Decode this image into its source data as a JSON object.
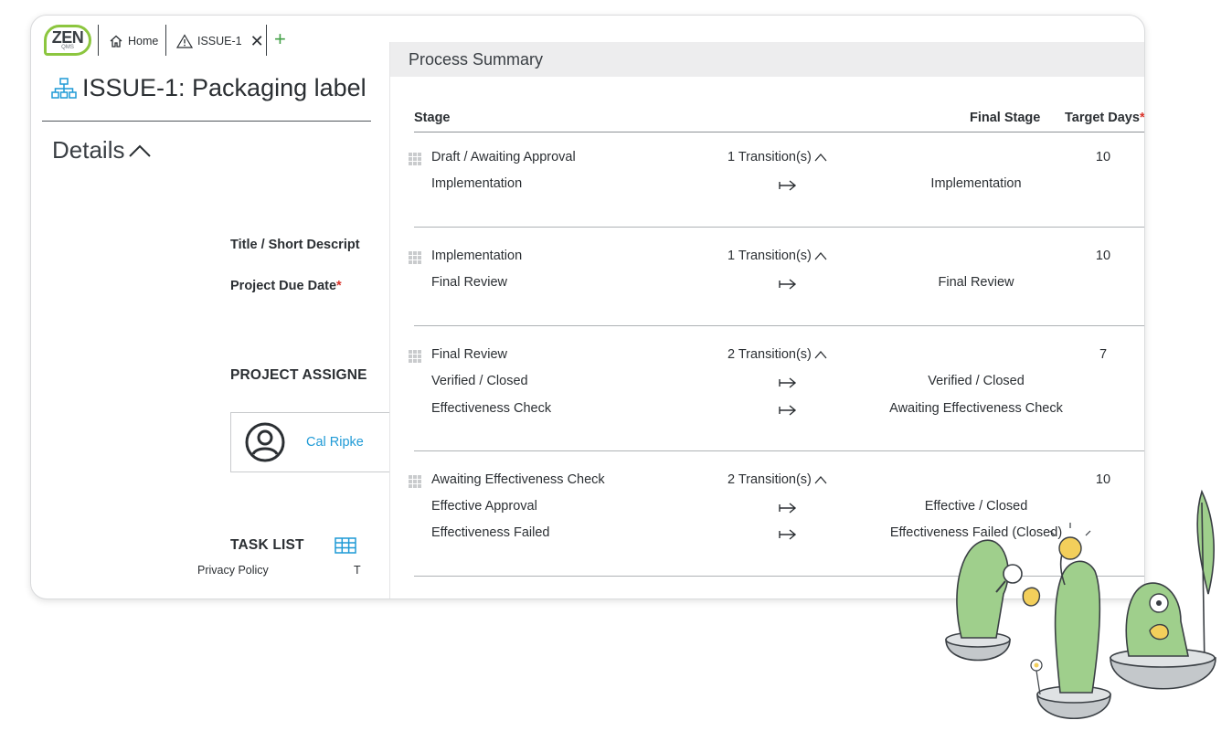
{
  "app": {
    "logo_text": "ZEN",
    "logo_sub": "QMS"
  },
  "tabs": [
    {
      "label": "Home",
      "icon": "home-icon"
    },
    {
      "label": "ISSUE-1",
      "icon": "warning-icon"
    }
  ],
  "page": {
    "title": "ISSUE-1: Packaging label",
    "title_icon": "org-chart-icon"
  },
  "details": {
    "heading": "Details",
    "fields": {
      "title_label": "Title / Short Descript",
      "due_date_label": "Project Due Date",
      "required_mark": "*"
    },
    "assignees_label": "PROJECT ASSIGNE",
    "assignee_name": "Cal Ripke",
    "task_list_label": "TASK LIST"
  },
  "footer": {
    "privacy": "Privacy Policy",
    "terms": "T"
  },
  "summary": {
    "title": "Process Summary",
    "columns": {
      "stage": "Stage",
      "final_stage": "Final Stage",
      "target_days": "Target Days",
      "required_mark": "*"
    },
    "stages": [
      {
        "name": "Draft / Awaiting Approval",
        "transitions_label": "1 Transition(s)",
        "target_days": "10",
        "transitions": [
          {
            "name": "Implementation",
            "final_stage": "Implementation"
          }
        ]
      },
      {
        "name": "Implementation",
        "transitions_label": "1 Transition(s)",
        "target_days": "10",
        "transitions": [
          {
            "name": "Final Review",
            "final_stage": "Final Review"
          }
        ]
      },
      {
        "name": "Final Review",
        "transitions_label": "2 Transition(s)",
        "target_days": "7",
        "transitions": [
          {
            "name": "Verified / Closed",
            "final_stage": "Verified / Closed"
          },
          {
            "name": "Effectiveness Check",
            "final_stage": "Awaiting Effectiveness Check"
          }
        ]
      },
      {
        "name": "Awaiting Effectiveness Check",
        "transitions_label": "2 Transition(s)",
        "target_days": "10",
        "transitions": [
          {
            "name": "Effective Approval",
            "final_stage": "Effective / Closed"
          },
          {
            "name": "Effectiveness Failed",
            "final_stage": "Effectiveness Failed (Closed)"
          }
        ]
      }
    ]
  },
  "colors": {
    "accent_green": "#8cc63f",
    "link_blue": "#1f9ad6",
    "required_red": "#d9342b",
    "header_gray": "#ededee",
    "illustration_green": "#9fcf8c"
  }
}
